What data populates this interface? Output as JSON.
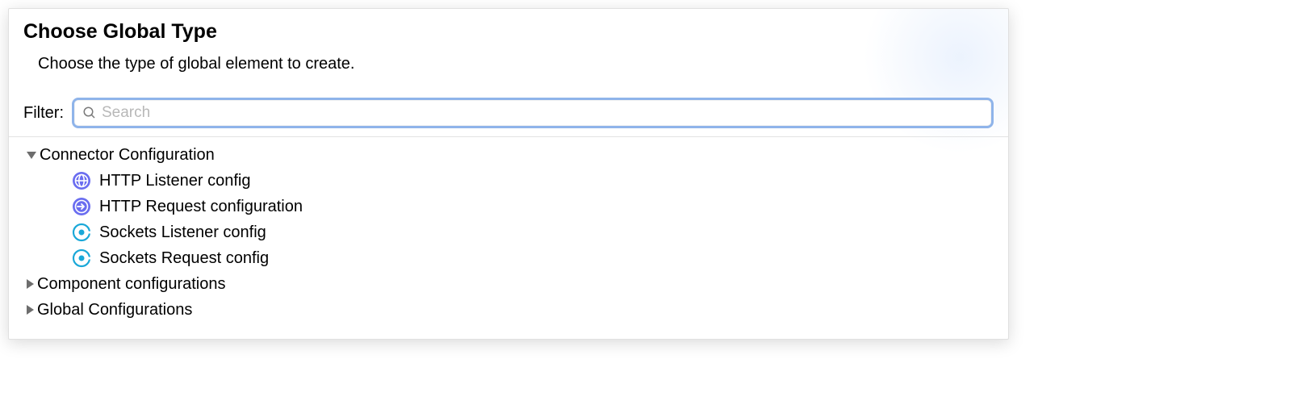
{
  "dialog": {
    "title": "Choose Global Type",
    "subtitle": "Choose the type of global element to create."
  },
  "filter": {
    "label": "Filter:",
    "placeholder": "Search",
    "value": ""
  },
  "tree": {
    "groups": [
      {
        "label": "Connector Configuration",
        "expanded": true,
        "items": [
          {
            "label": "HTTP Listener config",
            "icon": "http-icon"
          },
          {
            "label": "HTTP Request configuration",
            "icon": "http-request-icon"
          },
          {
            "label": "Sockets Listener config",
            "icon": "socket-icon"
          },
          {
            "label": "Sockets Request config",
            "icon": "socket-icon"
          }
        ]
      },
      {
        "label": "Component configurations",
        "expanded": false,
        "items": []
      },
      {
        "label": "Global Configurations",
        "expanded": false,
        "items": []
      }
    ]
  }
}
